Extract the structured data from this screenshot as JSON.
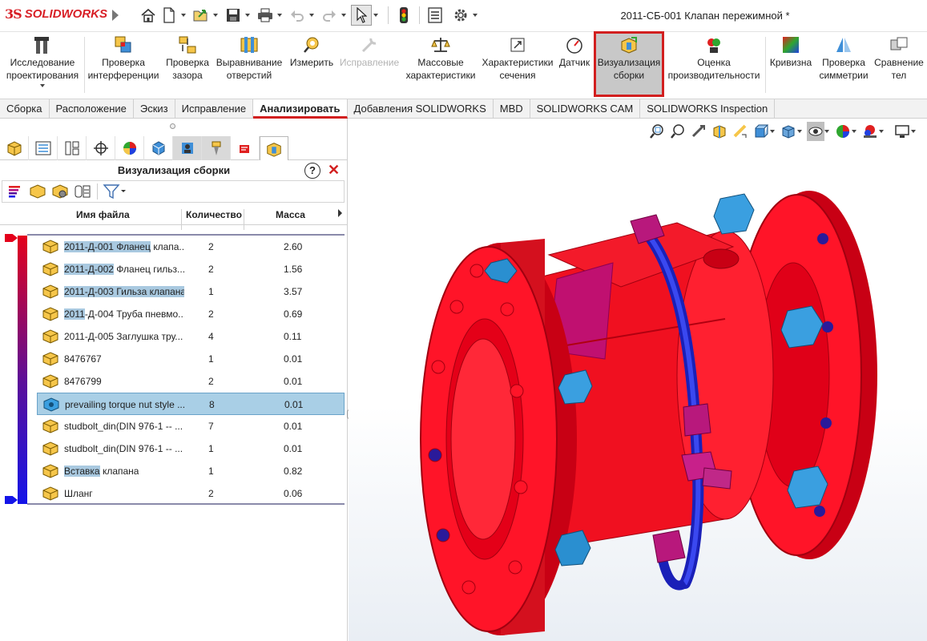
{
  "app": {
    "logo_ds": "3S",
    "logo_name": "SOLIDWORKS",
    "document_title": "2011-СБ-001 Клапан пережимной *"
  },
  "quick_access": [
    "home-icon",
    "new-document-icon",
    "open-icon",
    "save-icon",
    "print-icon",
    "undo-icon",
    "redo-icon",
    "select-icon",
    "rebuild-icon",
    "file-properties-icon",
    "options-icon"
  ],
  "ribbon": {
    "buttons": [
      {
        "label": "Исследование\nпроектирования",
        "icon": "design-study-icon",
        "enabled": true
      },
      {
        "label": "Проверка\nинтерференции",
        "icon": "interference-icon",
        "enabled": true
      },
      {
        "label": "Проверка\nзазора",
        "icon": "clearance-icon",
        "enabled": true
      },
      {
        "label": "Выравнивание\nотверстий",
        "icon": "hole-alignment-icon",
        "enabled": true
      },
      {
        "label": "Измерить",
        "icon": "measure-icon",
        "enabled": true
      },
      {
        "label": "Исправление",
        "icon": "fix-icon",
        "enabled": false
      },
      {
        "label": "Массовые\nхарактеристики",
        "icon": "mass-properties-icon",
        "enabled": true
      },
      {
        "label": "Характеристики\nсечения",
        "icon": "section-properties-icon",
        "enabled": true
      },
      {
        "label": "Датчик",
        "icon": "sensor-icon",
        "enabled": true
      },
      {
        "label": "Визуализация\nсборки",
        "icon": "assembly-visualization-icon",
        "enabled": true,
        "active": true
      },
      {
        "label": "Оценка\nпроизводительности",
        "icon": "performance-icon",
        "enabled": true
      },
      {
        "label": "Кривизна",
        "icon": "curvature-icon",
        "enabled": true
      },
      {
        "label": "Проверка\nсимметрии",
        "icon": "symmetry-icon",
        "enabled": true
      },
      {
        "label": "Сравнение\nтел",
        "icon": "compare-bodies-icon",
        "enabled": true
      }
    ]
  },
  "tabs": [
    {
      "label": "Сборка"
    },
    {
      "label": "Расположение"
    },
    {
      "label": "Эскиз"
    },
    {
      "label": "Исправление"
    },
    {
      "label": "Анализировать",
      "active": true
    },
    {
      "label": "Добавления SOLIDWORKS"
    },
    {
      "label": "MBD"
    },
    {
      "label": "SOLIDWORKS CAM"
    },
    {
      "label": "SOLIDWORKS Inspection"
    }
  ],
  "panel": {
    "title": "Визуализация сборки",
    "help": "?",
    "close": "✕",
    "columns": {
      "name": "Имя файла",
      "qty": "Количество",
      "mass": "Масса"
    },
    "rows": [
      {
        "hl": "2011-Д-001 Фланец",
        "rest": " клапа...",
        "qty": "2",
        "mass": "2.60",
        "icon": "part-icon"
      },
      {
        "hl": "2011-Д-002",
        "rest": " Фланец гильз...",
        "qty": "2",
        "mass": "1.56",
        "icon": "part-icon"
      },
      {
        "hl": "2011-Д-003 Гильза клапана",
        "rest": "",
        "qty": "1",
        "mass": "3.57",
        "icon": "part-icon"
      },
      {
        "hl": "2011",
        "rest": "-Д-004 Труба пневмо...",
        "qty": "2",
        "mass": "0.69",
        "icon": "part-icon"
      },
      {
        "hl": "",
        "rest": "2011-Д-005 Заглушка тру...",
        "qty": "4",
        "mass": "0.11",
        "icon": "part-icon"
      },
      {
        "hl": "",
        "rest": "8476767",
        "qty": "1",
        "mass": "0.01",
        "icon": "part-icon"
      },
      {
        "hl": "",
        "rest": "8476799",
        "qty": "2",
        "mass": "0.01",
        "icon": "part-icon"
      },
      {
        "hl": "",
        "rest": "prevailing torque nut style ...",
        "qty": "8",
        "mass": "0.01",
        "icon": "nut-icon",
        "selected": true
      },
      {
        "hl": "",
        "rest": "studbolt_din(DIN 976-1 -- ...",
        "qty": "7",
        "mass": "0.01",
        "icon": "part-icon"
      },
      {
        "hl": "",
        "rest": "studbolt_din(DIN 976-1 -- ...",
        "qty": "1",
        "mass": "0.01",
        "icon": "part-icon"
      },
      {
        "hl": "Вставка",
        "rest": " клапана",
        "qty": "1",
        "mass": "0.82",
        "icon": "part-icon"
      },
      {
        "hl": "",
        "rest": "Шланг",
        "qty": "2",
        "mass": "0.06",
        "icon": "part-icon"
      }
    ]
  },
  "colors": {
    "accent_red": "#d21f1f",
    "heavy": "#e4001b",
    "light": "#1414e8",
    "selection": "#a9cfe6",
    "model_red": "#f01020",
    "model_blue_bolt": "#2a8fd0",
    "model_magenta": "#b8187c",
    "model_hose": "#2030d8"
  }
}
